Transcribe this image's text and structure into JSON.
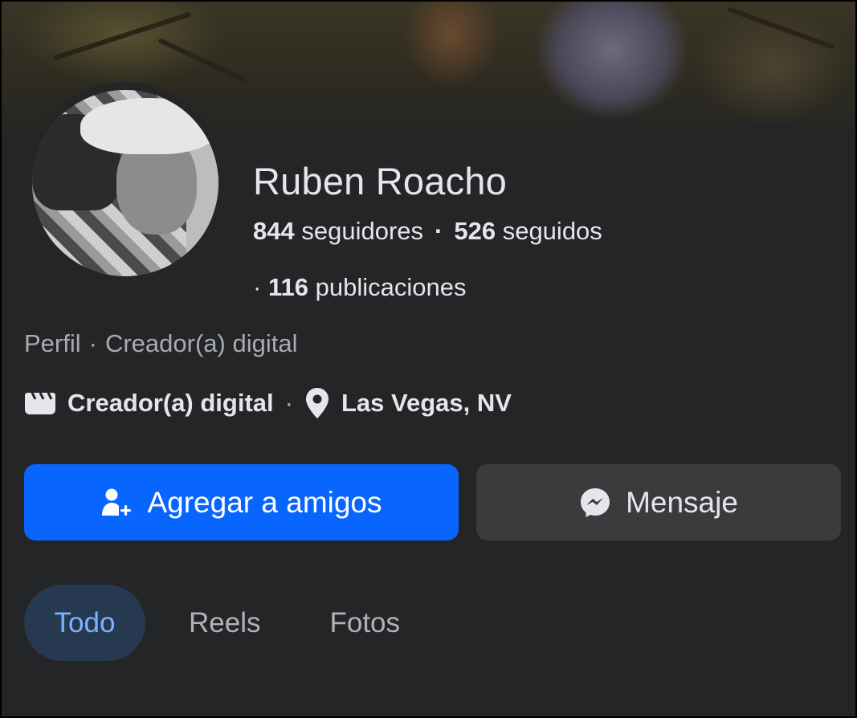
{
  "profile": {
    "name": "Ruben Roacho",
    "followers_count": "844",
    "followers_label": "seguidores",
    "following_count": "526",
    "following_label": "seguidos",
    "posts_count": "116",
    "posts_label": "publicaciones",
    "separator": "·",
    "meta_type": "Perfil",
    "meta_category": "Creador(a) digital",
    "category": "Creador(a) digital",
    "location": "Las Vegas, NV"
  },
  "actions": {
    "add_friend_label": "Agregar a amigos",
    "message_label": "Mensaje"
  },
  "tabs": [
    {
      "label": "Todo",
      "active": true
    },
    {
      "label": "Reels",
      "active": false
    },
    {
      "label": "Fotos",
      "active": false
    }
  ],
  "icons": {
    "category": "clapperboard-icon",
    "location": "location-pin-icon",
    "add_friend": "add-person-icon",
    "message": "messenger-icon"
  },
  "colors": {
    "background": "#242526",
    "primary_button": "#0866ff",
    "secondary_button": "#3a3b3c",
    "active_tab_bg": "#263951",
    "active_tab_text": "#7bb5ff",
    "text": "#e4e6eb",
    "muted_text": "#a8abaf"
  }
}
